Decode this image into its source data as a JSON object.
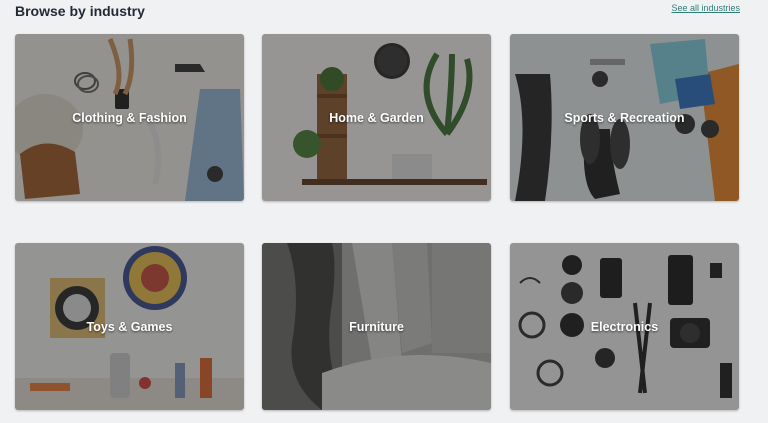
{
  "section": {
    "title": "Browse by industry",
    "see_all_label": "See all industries"
  },
  "industries": [
    {
      "label": "Clothing & Fashion",
      "icon": "clothing-photo"
    },
    {
      "label": "Home & Garden",
      "icon": "home-garden-photo"
    },
    {
      "label": "Sports & Recreation",
      "icon": "sports-photo"
    },
    {
      "label": "Toys & Games",
      "icon": "toys-photo"
    },
    {
      "label": "Furniture",
      "icon": "furniture-photo"
    },
    {
      "label": "Electronics",
      "icon": "electronics-photo"
    }
  ],
  "colors": {
    "background": "#f0f1f3",
    "heading": "#212b36",
    "link": "#2f7e75"
  }
}
